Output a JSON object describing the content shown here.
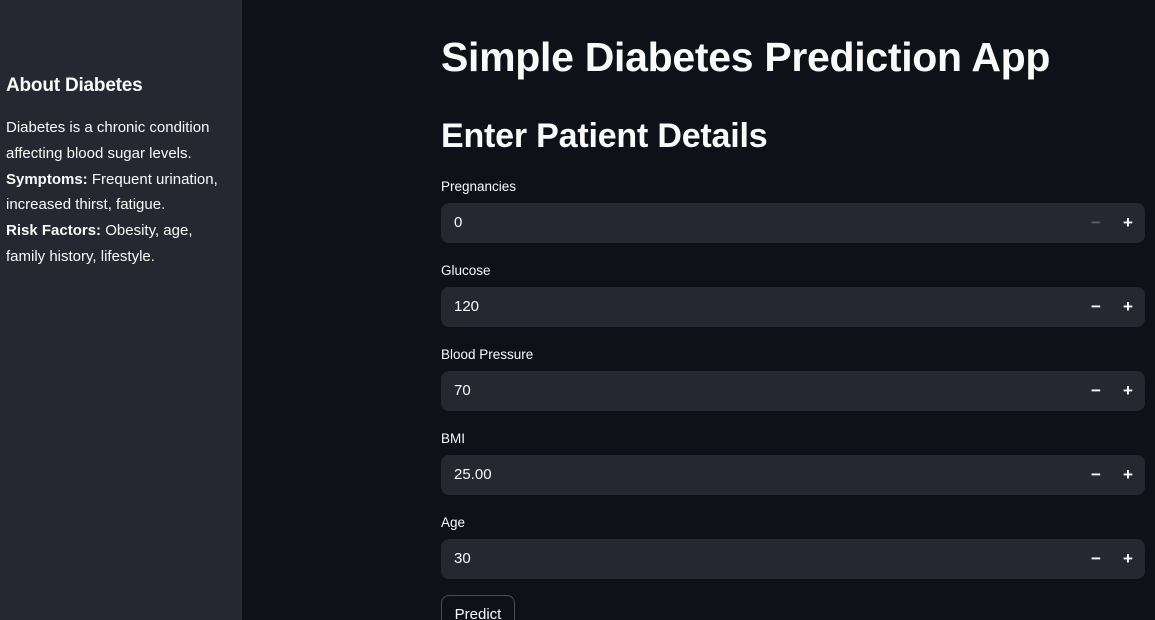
{
  "sidebar": {
    "heading": "About Diabetes",
    "lines": [
      {
        "bold": "",
        "text": "Diabetes is a chronic condition"
      },
      {
        "bold": "",
        "text": "affecting blood sugar levels."
      },
      {
        "bold": "Symptoms:",
        "text": " Frequent urination,"
      },
      {
        "bold": "",
        "text": "increased thirst, fatigue."
      },
      {
        "bold": "Risk Factors:",
        "text": " Obesity, age,"
      },
      {
        "bold": "",
        "text": "family history, lifestyle."
      }
    ]
  },
  "main": {
    "title": "Simple Diabetes Prediction App",
    "section_title": "Enter Patient Details",
    "fields": [
      {
        "label": "Pregnancies",
        "value": "0",
        "minus_icon": "minus-icon",
        "plus_icon": "plus-icon",
        "minus_disabled": true
      },
      {
        "label": "Glucose",
        "value": "120",
        "minus_icon": "minus-icon",
        "plus_icon": "plus-icon",
        "minus_disabled": false
      },
      {
        "label": "Blood Pressure",
        "value": "70",
        "minus_icon": "minus-icon",
        "plus_icon": "plus-icon",
        "minus_disabled": false
      },
      {
        "label": "BMI",
        "value": "25.00",
        "minus_icon": "minus-icon",
        "plus_icon": "plus-icon",
        "minus_disabled": false
      },
      {
        "label": "Age",
        "value": "30",
        "minus_icon": "minus-icon",
        "plus_icon": "plus-icon",
        "minus_disabled": false
      }
    ],
    "predict_label": "Predict"
  },
  "colors": {
    "background": "#0e1117",
    "sidebar": "#262730",
    "input": "#262730",
    "text": "#fafafa",
    "disabled": "#5a5c66"
  }
}
